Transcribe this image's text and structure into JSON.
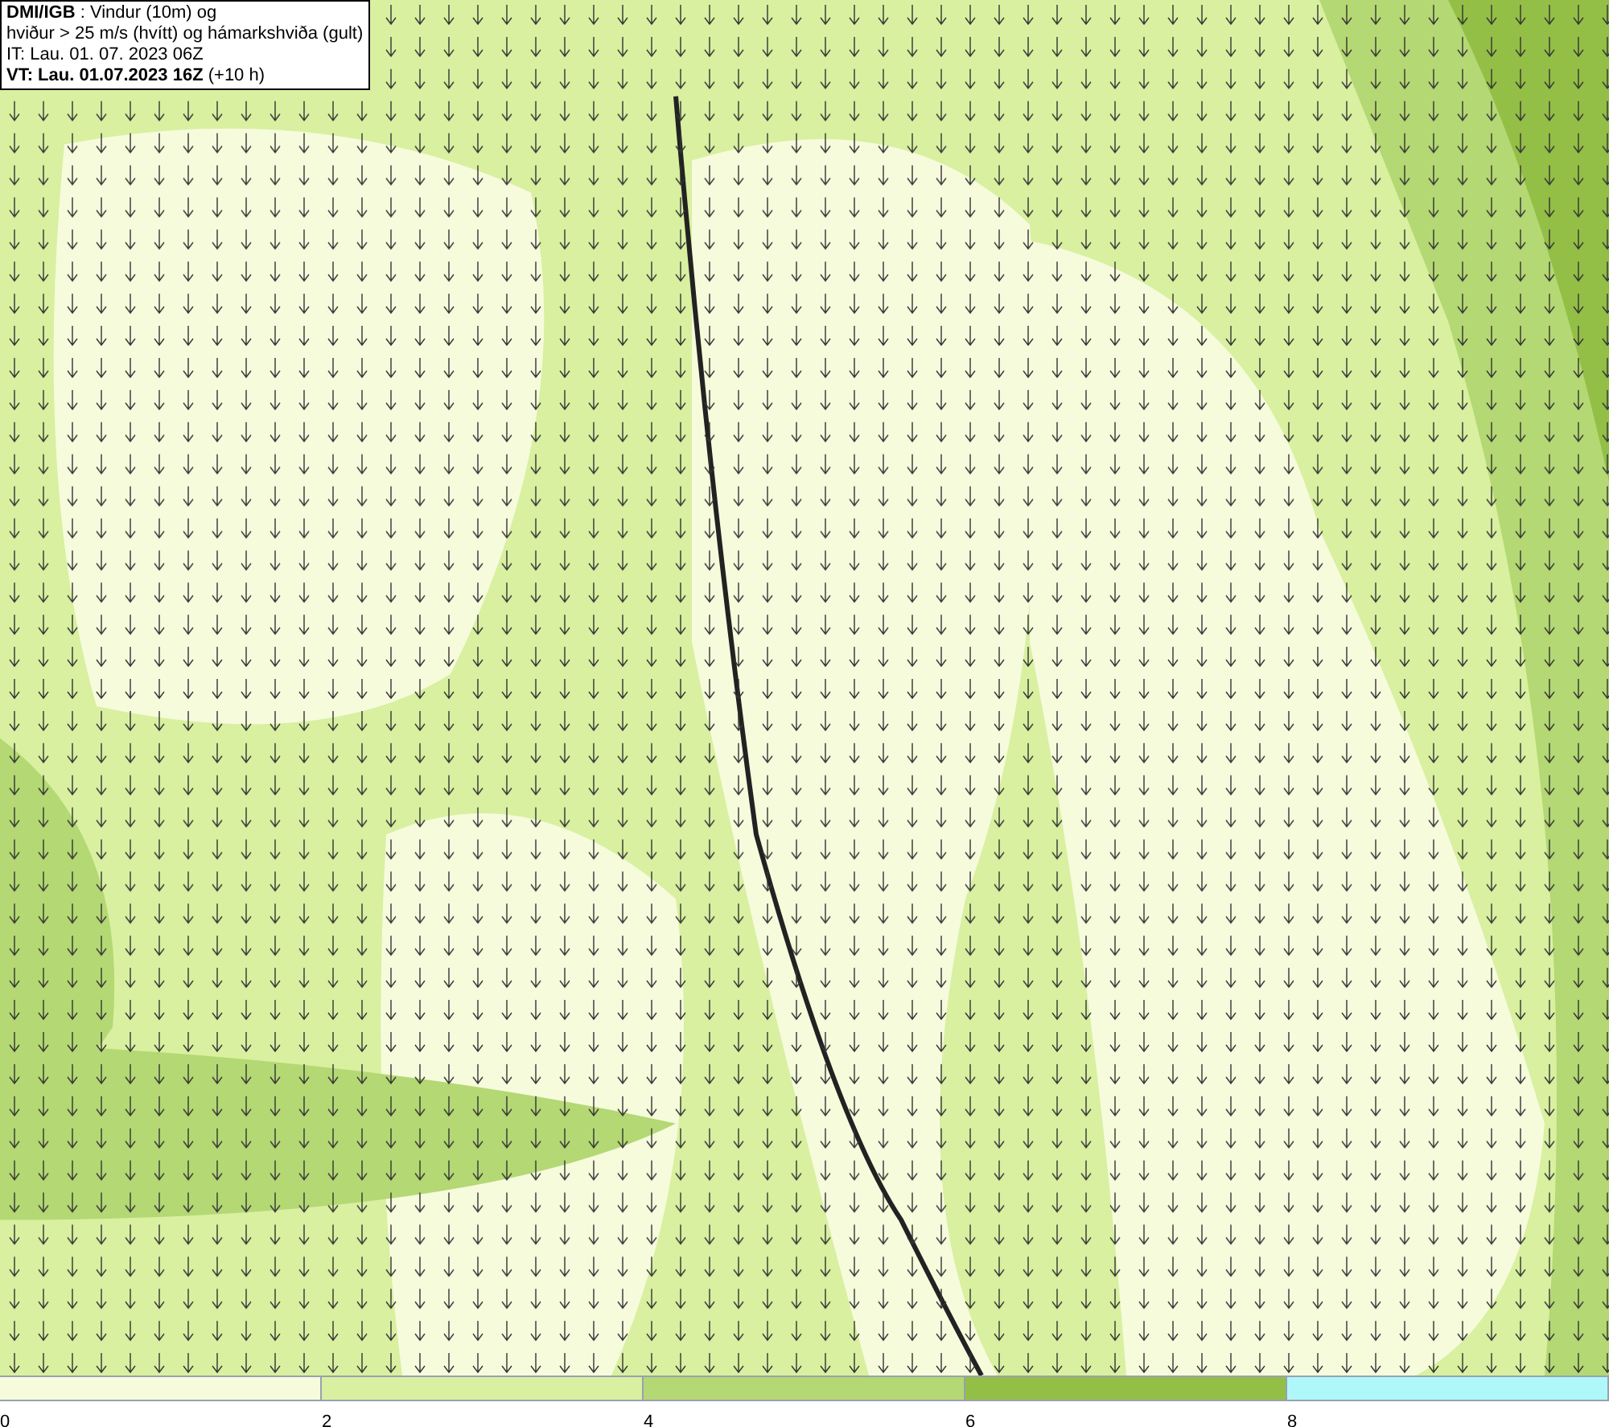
{
  "header": {
    "lines": [
      "**DMI/IGB** : Vindur (10m) og",
      "hviður > 25 m/s (hvítt) og hámarkshviða (gult)",
      "IT: Lau. 01. 07. 2023 06Z",
      "**VT: Lau. 01.07.2023 16Z** (+10 h)"
    ]
  },
  "legend": [
    {
      "label": "0",
      "color": "#f6fbdc"
    },
    {
      "label": "2",
      "color": "#d8f0a0"
    },
    {
      "label": "4",
      "color": "#b4d873"
    },
    {
      "label": "6",
      "color": "#93bf46"
    },
    {
      "label": "8",
      "color": "#aef8fa"
    }
  ]
}
